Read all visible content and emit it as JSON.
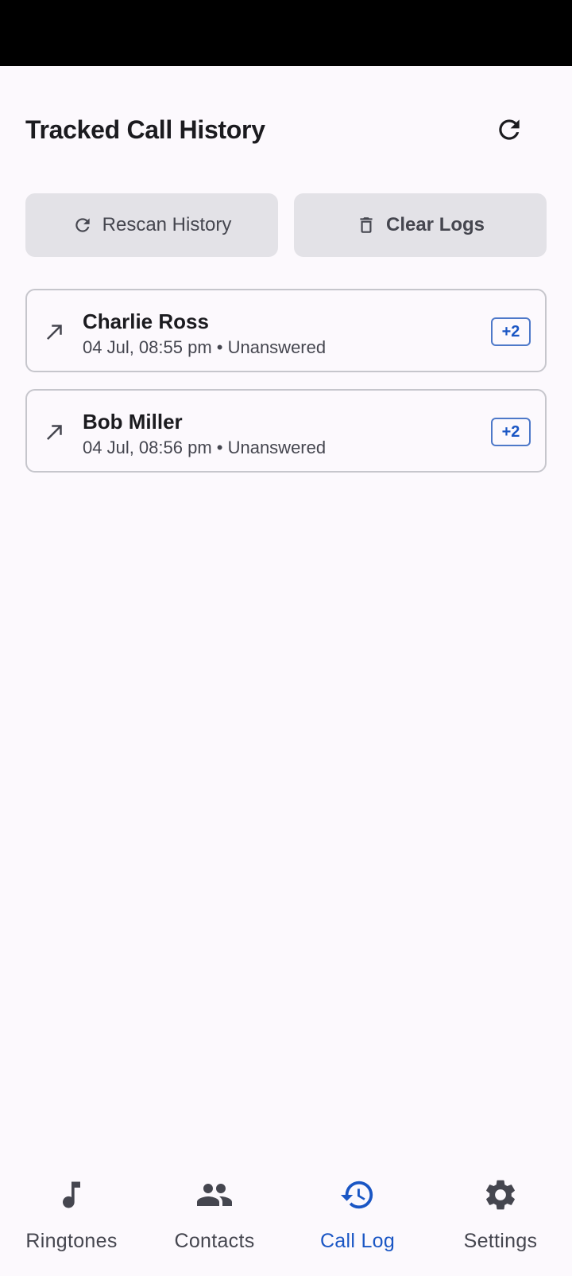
{
  "header": {
    "title": "Tracked Call History",
    "refresh_icon": "refresh-icon"
  },
  "actions": {
    "rescan_label": "Rescan History",
    "clear_label": "Clear Logs"
  },
  "calls": [
    {
      "name": "Charlie Ross",
      "meta": "04 Jul, 08:55 pm • Unanswered",
      "badge": "+2",
      "direction_icon": "outgoing-call-arrow-icon"
    },
    {
      "name": "Bob Miller",
      "meta": "04 Jul, 08:56 pm • Unanswered",
      "badge": "+2",
      "direction_icon": "outgoing-call-arrow-icon"
    }
  ],
  "nav": {
    "items": [
      {
        "label": "Ringtones",
        "icon": "music-note-icon",
        "active": false
      },
      {
        "label": "Contacts",
        "icon": "people-icon",
        "active": false
      },
      {
        "label": "Call Log",
        "icon": "history-icon",
        "active": true
      },
      {
        "label": "Settings",
        "icon": "gear-icon",
        "active": false
      }
    ]
  },
  "colors": {
    "accent": "#1a56c4",
    "background": "#fcf9fd",
    "button_bg": "#e3e2e7"
  }
}
